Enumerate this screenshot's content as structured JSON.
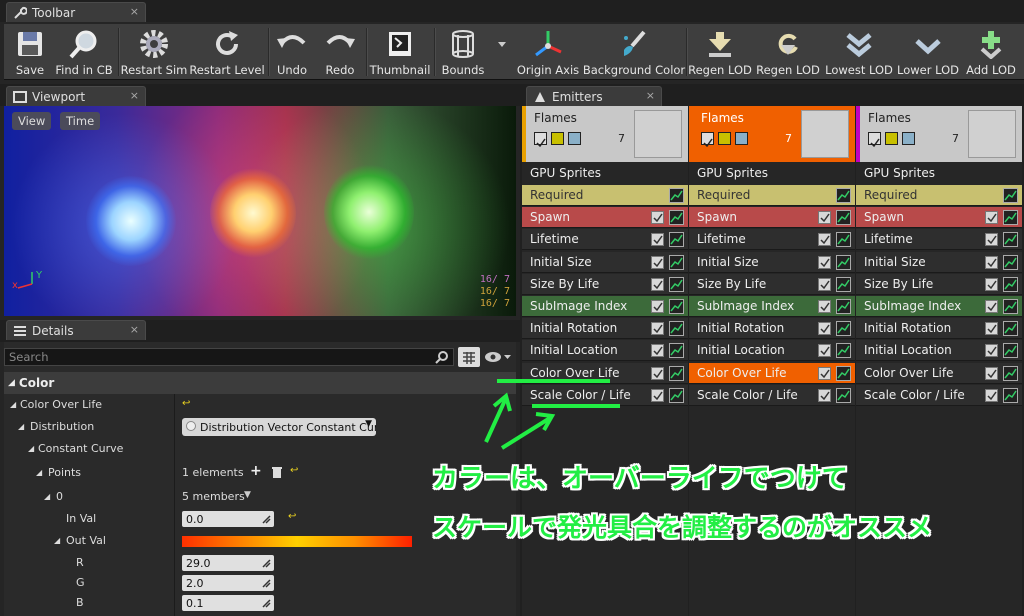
{
  "toolbar_tab": {
    "title": "Toolbar",
    "close": "×"
  },
  "toolbar": {
    "buttons": [
      {
        "label": "Save",
        "icon": "floppy-icon"
      },
      {
        "label": "Find in CB",
        "icon": "magnifier-icon"
      },
      {
        "label": "Restart Sim",
        "icon": "gear-icon"
      },
      {
        "label": "Restart Level",
        "icon": "restart-icon"
      },
      {
        "label": "Undo",
        "icon": "undo-icon"
      },
      {
        "label": "Redo",
        "icon": "redo-icon"
      },
      {
        "label": "Thumbnail",
        "icon": "thumbnail-icon"
      },
      {
        "label": "Bounds",
        "icon": "bounds-icon"
      },
      {
        "label": "Origin Axis",
        "icon": "axis-icon"
      },
      {
        "label": "Background Color",
        "icon": "brush-icon"
      },
      {
        "label": "Regen LOD",
        "icon": "regen-lod-icon"
      },
      {
        "label": "Regen LOD",
        "icon": "regen-lod-alt-icon"
      },
      {
        "label": "Lowest LOD",
        "icon": "lowest-lod-icon"
      },
      {
        "label": "Lower LOD",
        "icon": "lower-lod-icon"
      },
      {
        "label": "Add LOD",
        "icon": "add-lod-icon"
      }
    ]
  },
  "viewport_tab": {
    "title": "Viewport",
    "close": "×"
  },
  "viewport": {
    "view_label": "View",
    "time_label": "Time",
    "stats": [
      "16/  7",
      "16/  7",
      "16/  7"
    ],
    "axis_y": "Y",
    "axis_x": "x"
  },
  "details_tab": {
    "title": "Details",
    "close": "×"
  },
  "details": {
    "search_placeholder": "Search",
    "section": "Color",
    "rows": {
      "color_over_life": "Color Over Life",
      "distribution": "Distribution",
      "distribution_value": "Distribution Vector Constant Curve",
      "constant_curve": "Constant Curve",
      "points": "Points",
      "points_value": "1 elements",
      "zero": "0",
      "zero_value": "5 members",
      "in_val": "In Val",
      "in_val_value": "0.0",
      "out_val": "Out Val",
      "r": "R",
      "r_value": "29.0",
      "g": "G",
      "g_value": "2.0",
      "b": "B",
      "b_value": "0.1"
    }
  },
  "emitters_tab": {
    "title": "Emitters",
    "close": "×"
  },
  "emitters": [
    {
      "name": "Flames",
      "count": "7",
      "type": "GPU Sprites",
      "header_color": "#c8c8c8",
      "accent": "#e8a000",
      "modules": [
        "Required",
        "Spawn",
        "Lifetime",
        "Initial Size",
        "Size By Life",
        "SubImage Index",
        "Initial Rotation",
        "Initial Location",
        "Color Over Life",
        "Scale Color / Life"
      ]
    },
    {
      "name": "Flames",
      "count": "7",
      "type": "GPU Sprites",
      "header_color": "#f06000",
      "accent": "#f06000",
      "modules": [
        "Required",
        "Spawn",
        "Lifetime",
        "Initial Size",
        "Size By Life",
        "SubImage Index",
        "Initial Rotation",
        "Initial Location",
        "Color Over Life",
        "Scale Color / Life"
      ]
    },
    {
      "name": "Flames",
      "count": "7",
      "type": "GPU Sprites",
      "header_color": "#c8c8c8",
      "accent": "#c000c0",
      "modules": [
        "Required",
        "Spawn",
        "Lifetime",
        "Initial Size",
        "Size By Life",
        "SubImage Index",
        "Initial Rotation",
        "Initial Location",
        "Color Over Life",
        "Scale Color / Life"
      ]
    }
  ],
  "annotation": {
    "line1": "カラーは、オーバーライフでつけて",
    "line2": "スケールで発光具合を調整するのがオススメ",
    "color": "#22ee44"
  }
}
